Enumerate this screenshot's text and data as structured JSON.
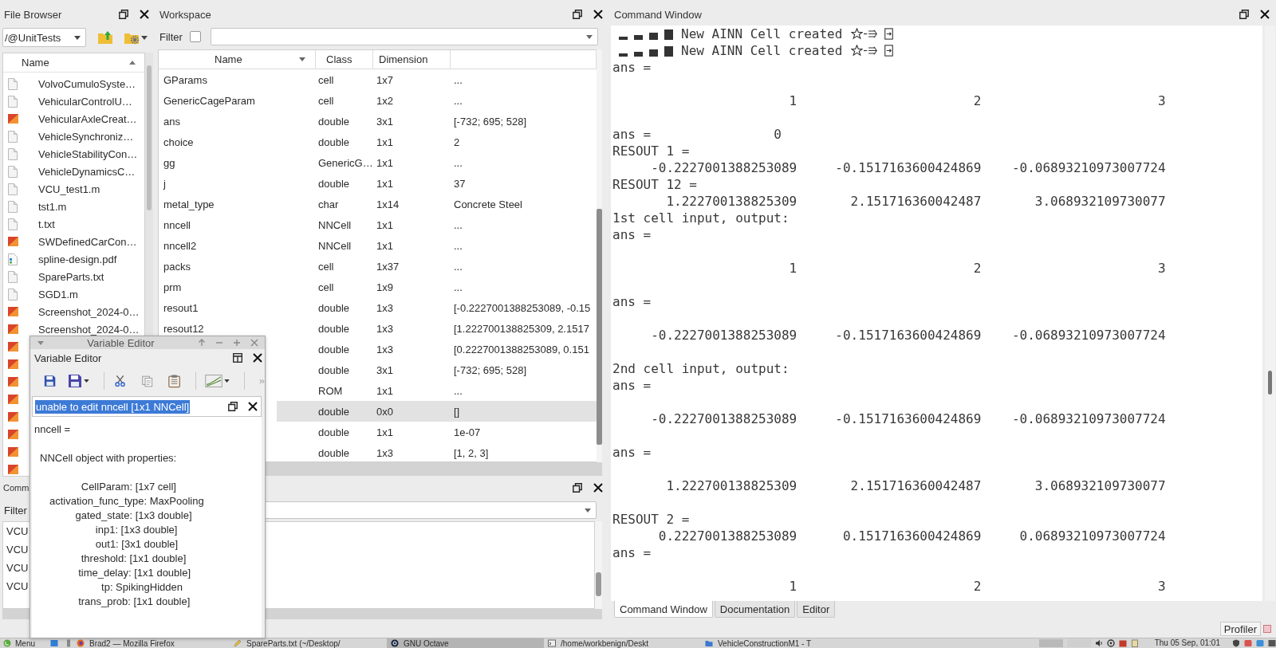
{
  "file_browser": {
    "title": "File Browser",
    "path": "/@UnitTests",
    "column": "Name",
    "files": [
      {
        "name": "VolvoCumuloSyste…",
        "kind": "document"
      },
      {
        "name": "VehicularControlU…",
        "kind": "document"
      },
      {
        "name": "VehicularAxleCreat…",
        "kind": "image"
      },
      {
        "name": "VehicleSynchroniz…",
        "kind": "document"
      },
      {
        "name": "VehicleStabilityCon…",
        "kind": "document"
      },
      {
        "name": "VehicleDynamicsC…",
        "kind": "document"
      },
      {
        "name": "VCU_test1.m",
        "kind": "document"
      },
      {
        "name": "tst1.m",
        "kind": "document"
      },
      {
        "name": "t.txt",
        "kind": "document"
      },
      {
        "name": "SWDefinedCarCon…",
        "kind": "image"
      },
      {
        "name": "spline-design.pdf",
        "kind": "pdf"
      },
      {
        "name": "SpareParts.txt",
        "kind": "document"
      },
      {
        "name": "SGD1.m",
        "kind": "document"
      },
      {
        "name": "Screenshot_2024-0…",
        "kind": "image"
      },
      {
        "name": "Screenshot_2024-0…",
        "kind": "image"
      },
      {
        "kind": "image"
      },
      {
        "kind": "image"
      },
      {
        "kind": "image"
      },
      {
        "kind": "image"
      },
      {
        "kind": "image"
      },
      {
        "kind": "image"
      },
      {
        "kind": "image"
      },
      {
        "kind": "image"
      }
    ]
  },
  "workspace": {
    "title": "Workspace",
    "filter_label": "Filter",
    "filter_checked": false,
    "columns": [
      "Name",
      "Class",
      "Dimension"
    ],
    "rows": [
      {
        "name": "GParams",
        "class": "cell",
        "dimension": "1x7",
        "value": "...",
        "selected": false
      },
      {
        "name": "GenericCageParam",
        "class": "cell",
        "dimension": "1x2",
        "value": "...",
        "selected": false
      },
      {
        "name": "ans",
        "class": "double",
        "dimension": "3x1",
        "value": "[-732; 695; 528]",
        "selected": false
      },
      {
        "name": "choice",
        "class": "double",
        "dimension": "1x1",
        "value": "2",
        "selected": false
      },
      {
        "name": "gg",
        "class": "GenericG…",
        "dimension": "1x1",
        "value": "...",
        "selected": false
      },
      {
        "name": "j",
        "class": "double",
        "dimension": "1x1",
        "value": "37",
        "selected": false
      },
      {
        "name": "metal_type",
        "class": "char",
        "dimension": "1x14",
        "value": "Concrete Steel",
        "selected": false
      },
      {
        "name": "nncell",
        "class": "NNCell",
        "dimension": "1x1",
        "value": "...",
        "selected": false
      },
      {
        "name": "nncell2",
        "class": "NNCell",
        "dimension": "1x1",
        "value": "...",
        "selected": false
      },
      {
        "name": "packs",
        "class": "cell",
        "dimension": "1x37",
        "value": "...",
        "selected": false
      },
      {
        "name": "prm",
        "class": "cell",
        "dimension": "1x9",
        "value": "...",
        "selected": false
      },
      {
        "name": "resout1",
        "class": "double",
        "dimension": "1x3",
        "value": "[-0.2227001388253089, -0.15",
        "selected": false
      },
      {
        "name": "resout12",
        "class": "double",
        "dimension": "1x3",
        "value": "[1.222700138825309, 2.1517",
        "selected": false
      },
      {
        "class": "double",
        "dimension": "1x3",
        "value": "[0.2227001388253089, 0.151",
        "selected": false
      },
      {
        "class": "double",
        "dimension": "3x1",
        "value": "[-732; 695; 528]",
        "selected": false
      },
      {
        "class": "ROM",
        "dimension": "1x1",
        "value": "...",
        "selected": false
      },
      {
        "class": "double",
        "dimension": "0x0",
        "value": "[]",
        "selected": true
      },
      {
        "class": "double",
        "dimension": "1x1",
        "value": "1e-07",
        "selected": false
      },
      {
        "class": "double",
        "dimension": "1x3",
        "value": "[1, 2, 3]",
        "selected": false
      }
    ]
  },
  "command_history": {
    "title": "Comm",
    "filter_label": "Filter",
    "entries": [
      "VCU",
      "VCU",
      "VCU",
      "VCU"
    ]
  },
  "variable_editor": {
    "window_title": "Variable Editor",
    "title": "Variable Editor",
    "tab": {
      "label": "unable to edit nncell [1x1 NNCell]",
      "highlighted": true
    },
    "lines": [
      {
        "kind": "text",
        "text": "nncell ="
      },
      {
        "kind": "blank"
      },
      {
        "kind": "heading",
        "text": "NNCell object with properties:"
      },
      {
        "kind": "blank"
      },
      {
        "kind": "property",
        "text": "CellParam: [1x7 cell]"
      },
      {
        "kind": "property",
        "text": "activation_func_type: MaxPooling"
      },
      {
        "kind": "property",
        "text": "gated_state: [1x3 double]"
      },
      {
        "kind": "property",
        "text": "inp1: [1x3 double]"
      },
      {
        "kind": "property",
        "text": "out1: [3x1 double]"
      },
      {
        "kind": "property",
        "text": "threshold: [1x1 double]"
      },
      {
        "kind": "property",
        "text": "time_delay: [1x1 double]"
      },
      {
        "kind": "property",
        "text": "tp: SpikingHidden"
      },
      {
        "kind": "property",
        "text": "trans_prob: [1x1 double]"
      }
    ]
  },
  "command_window": {
    "title": "Command Window",
    "lines": [
      {
        "kind": "notice",
        "text": "New AINN Cell created"
      },
      {
        "kind": "notice",
        "text": "New AINN Cell created"
      },
      {
        "kind": "text",
        "text": "ans ="
      },
      {
        "kind": "blank"
      },
      {
        "kind": "row",
        "values": [
          "1",
          "2",
          "3"
        ]
      },
      {
        "kind": "blank"
      },
      {
        "kind": "scalar",
        "label": "ans =",
        "value": "0"
      },
      {
        "kind": "text",
        "text": "RESOUT 1 ="
      },
      {
        "kind": "row",
        "values": [
          "-0.2227001388253089",
          "-0.1517163600424869",
          "-0.06893210973007724"
        ]
      },
      {
        "kind": "text",
        "text": "RESOUT 12 ="
      },
      {
        "kind": "row",
        "values": [
          "1.222700138825309",
          "2.151716360042487",
          "3.068932109730077"
        ]
      },
      {
        "kind": "text",
        "text": "1st cell input, output:"
      },
      {
        "kind": "text",
        "text": "ans ="
      },
      {
        "kind": "blank"
      },
      {
        "kind": "row",
        "values": [
          "1",
          "2",
          "3"
        ]
      },
      {
        "kind": "blank"
      },
      {
        "kind": "text",
        "text": "ans ="
      },
      {
        "kind": "blank"
      },
      {
        "kind": "row",
        "values": [
          "-0.2227001388253089",
          "-0.1517163600424869",
          "-0.06893210973007724"
        ]
      },
      {
        "kind": "blank"
      },
      {
        "kind": "text",
        "text": "2nd cell input, output:"
      },
      {
        "kind": "text",
        "text": "ans ="
      },
      {
        "kind": "blank"
      },
      {
        "kind": "row",
        "values": [
          "-0.2227001388253089",
          "-0.1517163600424869",
          "-0.06893210973007724"
        ]
      },
      {
        "kind": "blank"
      },
      {
        "kind": "text",
        "text": "ans ="
      },
      {
        "kind": "blank"
      },
      {
        "kind": "row",
        "values": [
          "1.222700138825309",
          "2.151716360042487",
          "3.068932109730077"
        ]
      },
      {
        "kind": "blank"
      },
      {
        "kind": "text",
        "text": "RESOUT 2 ="
      },
      {
        "kind": "row",
        "values": [
          "0.2227001388253089",
          "0.1517163600424869",
          "0.06893210973007724"
        ]
      },
      {
        "kind": "text",
        "text": "ans ="
      },
      {
        "kind": "blank"
      },
      {
        "kind": "row",
        "values": [
          "1",
          "2",
          "3"
        ]
      }
    ],
    "tabs": [
      {
        "label": "Command Window",
        "selected": true
      },
      {
        "label": "Documentation",
        "selected": false
      },
      {
        "label": "Editor",
        "selected": false
      }
    ]
  },
  "status_bar": {
    "button": "Profiler"
  },
  "taskbar": {
    "menu": "Menu",
    "tasks": [
      {
        "label": "Brad2 — Mozilla Firefox",
        "kind": "browser",
        "selected": false
      },
      {
        "label": "SpareParts.txt (~/Desktop/",
        "kind": "editor",
        "selected": false
      },
      {
        "label": "GNU Octave",
        "kind": "octave",
        "selected": true
      },
      {
        "label": "/home/workbenign/Deskt",
        "kind": "terminal",
        "selected": false
      },
      {
        "label": "VehicleConstructionM1 - T",
        "kind": "folder",
        "selected": false
      }
    ],
    "clock": "Thu 05 Sep, 01:01"
  }
}
